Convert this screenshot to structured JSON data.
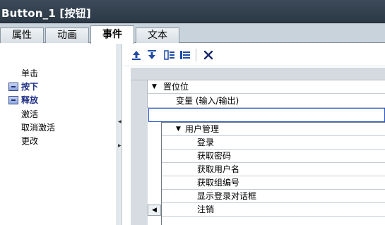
{
  "window": {
    "title": "Button_1 [按钮]"
  },
  "tabs": [
    {
      "label": "属性"
    },
    {
      "label": "动画"
    },
    {
      "label": "事件"
    },
    {
      "label": "文本"
    }
  ],
  "events": [
    {
      "label": "单击"
    },
    {
      "label": "按下"
    },
    {
      "label": "释放"
    },
    {
      "label": "激活"
    },
    {
      "label": "取消激活"
    },
    {
      "label": "更改"
    }
  ],
  "toolbar": {
    "icons": [
      "move-up-icon",
      "move-down-icon",
      "collapse-icon",
      "expand-icon",
      "delete-icon"
    ]
  },
  "function_list": {
    "function_name": "置位位",
    "param_label": "变量 (输入/输出)",
    "param_value": "",
    "dropdown_group": "用户管理",
    "dropdown_items": [
      {
        "label": "登录"
      },
      {
        "label": "获取密码"
      },
      {
        "label": "获取用户名"
      },
      {
        "label": "获取组编号"
      },
      {
        "label": "显示登录对话框"
      },
      {
        "label": "注销"
      }
    ]
  },
  "colors": {
    "title_bg": "#2f3c48",
    "selected_event_text": "#1c2c84",
    "edit_border": "#2a56c6"
  }
}
